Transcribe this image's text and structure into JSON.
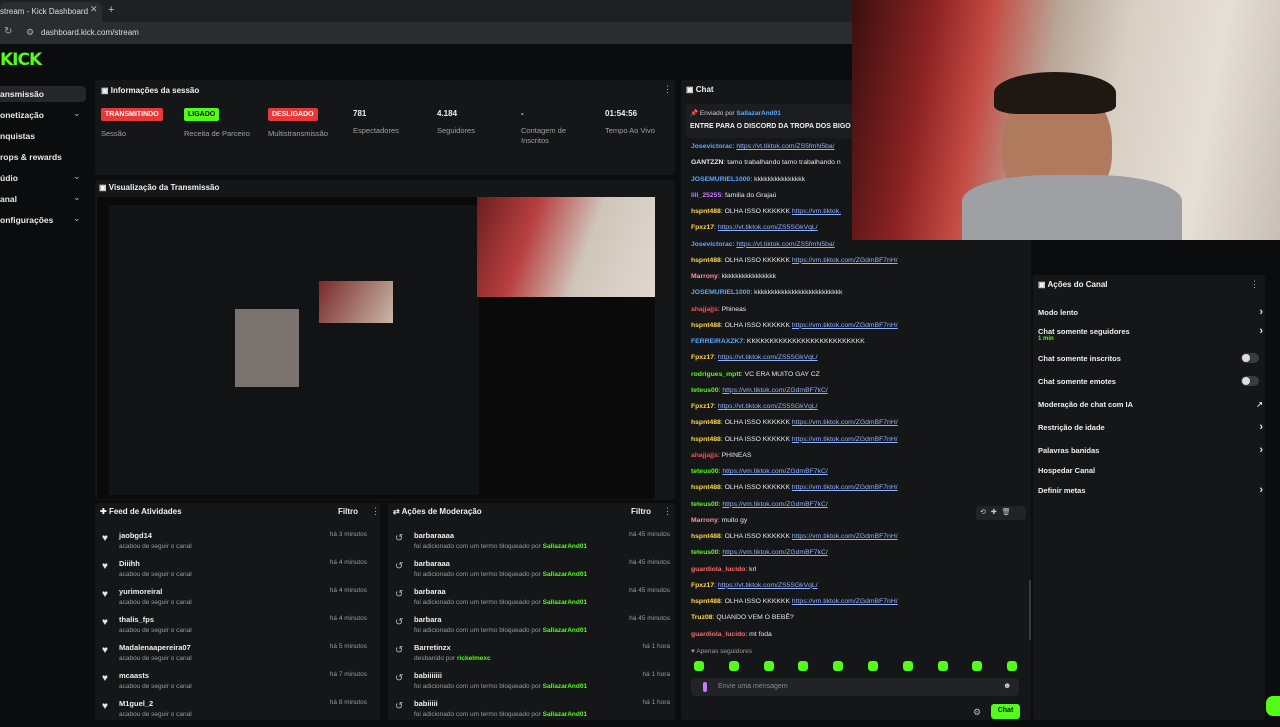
{
  "browser": {
    "tab_title": "stream - Kick Dashboard",
    "url": "dashboard.kick.com/stream",
    "close": "✕",
    "new_tab": "+"
  },
  "logo": "KICK",
  "nav": [
    {
      "label": "ansmissão",
      "chevron": ""
    },
    {
      "label": "onetização",
      "chevron": "⌄"
    },
    {
      "label": "nquistas",
      "chevron": ""
    },
    {
      "label": "rops & rewards",
      "chevron": ""
    },
    {
      "label": "údio",
      "chevron": "⌄"
    },
    {
      "label": "anal",
      "chevron": "⌄"
    },
    {
      "label": "onfigurações",
      "chevron": "⌄"
    }
  ],
  "session": {
    "title": "Informações da sessão",
    "badges": [
      {
        "text": "TRANSMITINDO",
        "label": "Sessão",
        "color": "#e63a3a"
      },
      {
        "text": "LIGADO",
        "label": "Receita de Parceiro",
        "color": "#53fc18"
      },
      {
        "text": "DESLIGADO",
        "label": "Multistransmissão",
        "color": "#e63a3a"
      }
    ],
    "stats": [
      {
        "value": "781",
        "label": "Espectadores"
      },
      {
        "value": "4.184",
        "label": "Seguidores"
      },
      {
        "value": "-",
        "label": "Contagem de Inscritos"
      },
      {
        "value": "01:54:56",
        "label": "Tempo Ao Vivo"
      }
    ]
  },
  "preview": {
    "title": "Visualização da Transmissão"
  },
  "feed": {
    "title": "Feed de Atividades",
    "filter": "Filtro",
    "items": [
      {
        "name": "jaobgd14",
        "sub": "acabou de seguir o canal",
        "time": "há 3 minutos"
      },
      {
        "name": "Diiihh",
        "sub": "acabou de seguir o canal",
        "time": "há 4 minutos"
      },
      {
        "name": "yurimoreiral",
        "sub": "acabou de seguir o canal",
        "time": "há 4 minutos"
      },
      {
        "name": "thalis_fps",
        "sub": "acabou de seguir o canal",
        "time": "há 4 minutos"
      },
      {
        "name": "Madalenaapereira07",
        "sub": "acabou de seguir o canal",
        "time": "há 5 minutos"
      },
      {
        "name": "mcaasts",
        "sub": "acabou de seguir o canal",
        "time": "há 7 minutos"
      },
      {
        "name": "M1guel_2",
        "sub": "acabou de seguir o canal",
        "time": "há 8 minutos"
      }
    ]
  },
  "moderation": {
    "title": "Ações de Moderação",
    "filter": "Filtro",
    "items": [
      {
        "name": "barbaraaaa",
        "sub": "foi adicionado com um termo bloqueado por",
        "by": "SallazarAnd01",
        "time": "há 45 minutos"
      },
      {
        "name": "barbaraaa",
        "sub": "foi adicionado com um termo bloqueado por",
        "by": "SallazarAnd01",
        "time": "há 45 minutos"
      },
      {
        "name": "barbaraa",
        "sub": "foi adicionado com um termo bloqueado por",
        "by": "SallazarAnd01",
        "time": "há 45 minutos"
      },
      {
        "name": "barbara",
        "sub": "foi adicionado com um termo bloqueado por",
        "by": "SallazarAnd01",
        "time": "há 45 minutos"
      },
      {
        "name": "Barretinzx",
        "sub": "desbanido por",
        "by": "rickelmexc",
        "time": "há 1 hora"
      },
      {
        "name": "babiiiiiii",
        "sub": "foi adicionado com um termo bloqueado por",
        "by": "SallazarAnd01",
        "time": "há 1 hora"
      },
      {
        "name": "babiiiii",
        "sub": "foi adicionado com um termo bloqueado por",
        "by": "SallazarAnd01",
        "time": "há 1 hora"
      }
    ]
  },
  "chat": {
    "title": "Chat",
    "pinned_by_prefix": "Enviado por",
    "pinned_by": "SallazarAnd01",
    "pinned_text": "ENTRE PARA O DISCORD DA TROPA DOS BIGO",
    "messages": [
      {
        "user": "Josevictorac",
        "color": "#5aa9ff",
        "text": "",
        "link": "https://vt.tiktok.com/ZS5fmN5ba/"
      },
      {
        "user": "GANTZZN",
        "color": "#e8e8e8",
        "text": "tamo trabalhando tamo trabalhando n",
        "link": ""
      },
      {
        "user": "JOSEMURIEL1000",
        "color": "#5aa9ff",
        "text": "kkkkkkkkkkkkkkk",
        "link": ""
      },
      {
        "user": "lili_25255",
        "color": "#c57bff",
        "text": "familia do Grajaú",
        "link": ""
      },
      {
        "user": "hspnt488",
        "color": "#ffd94a",
        "text": "OLHA ISSO KKKKKK",
        "link": "https://vm.tiktok."
      },
      {
        "user": "Fpxz17",
        "color": "#ffd94a",
        "text": "",
        "link": "https://vt.tiktok.com/ZS5SGkVqL/"
      },
      {
        "user": "Josevictorac",
        "color": "#5aa9ff",
        "text": "",
        "link": "https://vt.tiktok.com/ZS5fmN5ba/"
      },
      {
        "user": "hspnt488",
        "color": "#ffd94a",
        "text": "OLHA ISSO KKKKKK",
        "link": "https://vm.tiktok.com/ZGdmBF7nH/"
      },
      {
        "user": "Marrony",
        "color": "#ff8fb0",
        "text": "kkkkkkkkkkkkkkkk",
        "link": ""
      },
      {
        "user": "JOSEMURIEL1000",
        "color": "#5aa9ff",
        "text": "kkkkkkkkkkkkkkkkkkkkkkkkkk",
        "link": ""
      },
      {
        "user": "ahajjajjs",
        "color": "#ff4d4d",
        "text": "Phineas",
        "link": ""
      },
      {
        "user": "hspnt488",
        "color": "#ffd94a",
        "text": "OLHA ISSO KKKKKK",
        "link": "https://vm.tiktok.com/ZGdmBF7nH/"
      },
      {
        "user": "FERREIRAXZK7",
        "color": "#5aa9ff",
        "text": "KKKKKKKKKKKKKKKKKKKKKKKKKK",
        "link": ""
      },
      {
        "user": "Fpxz17",
        "color": "#ffd94a",
        "text": "",
        "link": "https://vt.tiktok.com/ZS5SGkVqL/"
      },
      {
        "user": "rodrigues_mptt",
        "color": "#53fc18",
        "text": "VC ERA MUITO GAY CZ",
        "link": ""
      },
      {
        "user": "teteus00",
        "color": "#53fc18",
        "text": "",
        "link": "https://vm.tiktok.com/ZGdmBF7kC/"
      },
      {
        "user": "Fpxz17",
        "color": "#ffd94a",
        "text": "",
        "link": "https://vt.tiktok.com/ZS5SGkVqL/"
      },
      {
        "user": "hspnt488",
        "color": "#ffd94a",
        "text": "OLHA ISSO KKKKKK",
        "link": "https://vm.tiktok.com/ZGdmBF7nH/"
      },
      {
        "user": "hspnt488",
        "color": "#ffd94a",
        "text": "OLHA ISSO KKKKKK",
        "link": "https://vm.tiktok.com/ZGdmBF7nH/"
      },
      {
        "user": "ahajjajjs",
        "color": "#ff4d4d",
        "text": "PHINEAS",
        "link": ""
      },
      {
        "user": "teteus00",
        "color": "#53fc18",
        "text": "",
        "link": "https://vm.tiktok.com/ZGdmBF7kC/"
      },
      {
        "user": "hspnt488",
        "color": "#ffd94a",
        "text": "OLHA ISSO KKKKKK",
        "link": "https://vm.tiktok.com/ZGdmBF7nH/"
      },
      {
        "user": "teteus00",
        "color": "#53fc18",
        "text": "",
        "link": "https://vm.tiktok.com/ZGdmBF7kC/"
      },
      {
        "user": "Marrony",
        "color": "#ff8fb0",
        "text": "muito gy",
        "link": ""
      },
      {
        "user": "hspnt488",
        "color": "#ffd94a",
        "text": "OLHA ISSO KKKKKK",
        "link": "https://vm.tiktok.com/ZGdmBF7nH/"
      },
      {
        "user": "teteus00",
        "color": "#53fc18",
        "text": "",
        "link": "https://vm.tiktok.com/ZGdmBF7kC/"
      },
      {
        "user": "guardiola_lucido",
        "color": "#ff6b6b",
        "text": "krl",
        "link": ""
      },
      {
        "user": "Fpxz17",
        "color": "#ffd94a",
        "text": "",
        "link": "https://vt.tiktok.com/ZS5SGkVqL/"
      },
      {
        "user": "hspnt488",
        "color": "#ffd94a",
        "text": "OLHA ISSO KKKKKK",
        "link": "https://vm.tiktok.com/ZGdmBF7nH/"
      },
      {
        "user": "Truz08",
        "color": "#ffd94a",
        "text": "QUANDO VEM O BEBÊ?",
        "link": ""
      },
      {
        "user": "guardiola_lucido",
        "color": "#ff6b6b",
        "text": "mt foda",
        "link": ""
      }
    ],
    "followers_only": "Apenas seguidores",
    "input_placeholder": "Envie uma mensagem",
    "send_label": "Chat"
  },
  "channel_actions": {
    "title": "Ações do Canal",
    "items": [
      {
        "label": "Modo lento",
        "sub": "",
        "control": "chevron"
      },
      {
        "label": "Chat somente seguidores",
        "sub": "1 min",
        "control": "chevron"
      },
      {
        "label": "Chat somente inscritos",
        "sub": "",
        "control": "toggle"
      },
      {
        "label": "Chat somente emotes",
        "sub": "",
        "control": "toggle"
      },
      {
        "label": "Moderação de chat com IA",
        "sub": "",
        "control": "external"
      },
      {
        "label": "Restrição de idade",
        "sub": "",
        "control": "chevron"
      },
      {
        "label": "Palavras banidas",
        "sub": "",
        "control": "chevron"
      },
      {
        "label": "Hospedar Canal",
        "sub": "",
        "control": "none"
      },
      {
        "label": "Definir metas",
        "sub": "",
        "control": "chevron"
      }
    ]
  },
  "colors": {
    "accent": "#53fc18",
    "live": "#e63a3a",
    "panel": "#151618"
  }
}
